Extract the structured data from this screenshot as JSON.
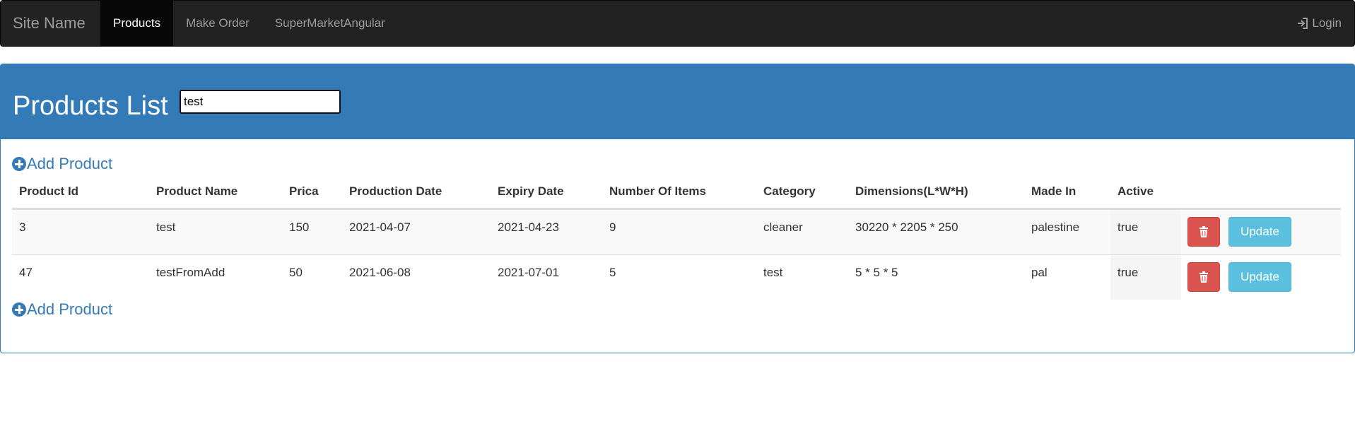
{
  "navbar": {
    "brand": "Site Name",
    "links": [
      {
        "label": "Products",
        "active": true
      },
      {
        "label": "Make Order",
        "active": false
      },
      {
        "label": "SuperMarketAngular",
        "active": false
      }
    ],
    "login_label": "Login",
    "login_icon": "login-icon"
  },
  "panel": {
    "title": "Products List",
    "add_product_label": "Add Product",
    "add_product_icon": "plus-circle-icon"
  },
  "search": {
    "value": "test",
    "placeholder": ""
  },
  "table": {
    "headers": [
      "Product Id",
      "Product Name",
      "Prica",
      "Production Date",
      "Expiry Date",
      "Number Of Items",
      "Category",
      "Dimensions(L*W*H)",
      "Made In",
      "Active"
    ],
    "rows": [
      [
        "3",
        "test",
        "150",
        "2021-04-07",
        "2021-04-23",
        "9",
        "cleaner",
        "30220 * 2205 * 250",
        "palestine",
        "true"
      ],
      [
        "47",
        "testFromAdd",
        "50",
        "2021-06-08",
        "2021-07-01",
        "5",
        "test",
        "5 * 5 * 5",
        "pal",
        "true"
      ]
    ],
    "delete_icon": "trash-icon",
    "update_label": "Update"
  },
  "colors": {
    "navbar_bg": "#222222",
    "panel_primary": "#337ab7",
    "danger": "#d9534f",
    "info": "#5bc0de"
  }
}
